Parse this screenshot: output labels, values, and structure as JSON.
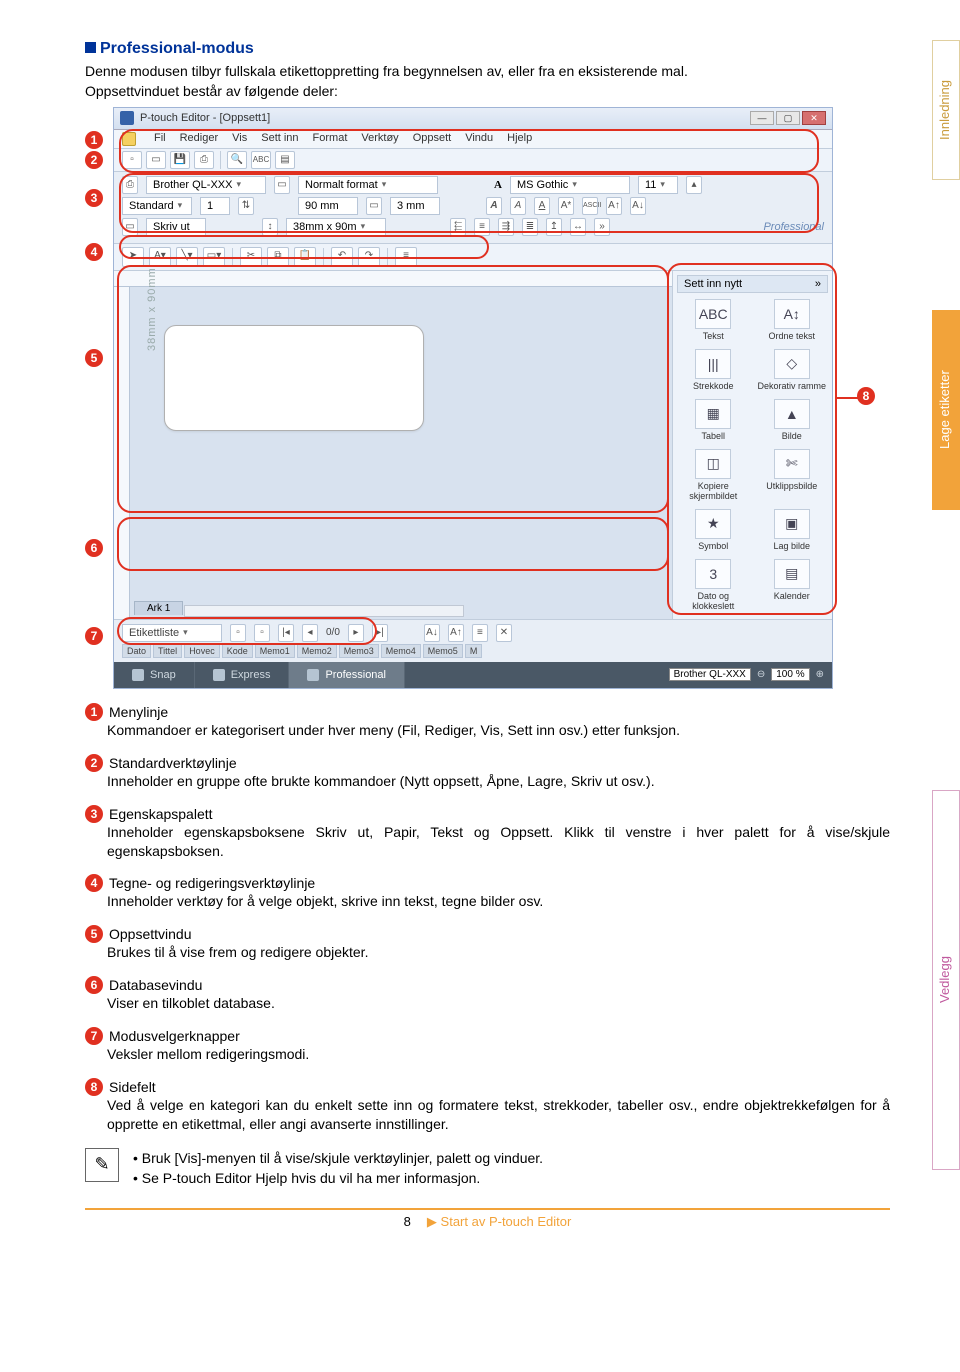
{
  "header": "Professional-modus",
  "intro_line1": "Denne modusen tilbyr fullskala etikettoppretting fra begynnelsen av, eller fra en eksisterende mal.",
  "intro_line2": "Oppsettvinduet består av følgende deler:",
  "side_tabs": {
    "top": "Innledning",
    "mid": "Lage etiketter",
    "bot": "Vedlegg"
  },
  "screenshot": {
    "title": "P-touch Editor - [Oppsett1]",
    "menus": [
      "Fil",
      "Rediger",
      "Vis",
      "Sett inn",
      "Format",
      "Verktøy",
      "Oppsett",
      "Vindu",
      "Hjelp"
    ],
    "printer": "Brother QL-XXX",
    "format": "Normalt format",
    "font": "MS Gothic",
    "fontsize": "11",
    "standard": "Standard",
    "qty": "1",
    "w": "90 mm",
    "h": "3 mm",
    "skrivut": "Skriv ut",
    "dims": "38mm x 90m",
    "mode_label": "Professional",
    "side_header": "Sett inn nytt",
    "side_items": [
      {
        "icon": "ABC",
        "label": "Tekst"
      },
      {
        "icon": "A↕",
        "label": "Ordne tekst"
      },
      {
        "icon": "|||",
        "label": "Strekkode"
      },
      {
        "icon": "◇",
        "label": "Dekorativ ramme"
      },
      {
        "icon": "▦",
        "label": "Tabell"
      },
      {
        "icon": "▲",
        "label": "Bilde"
      },
      {
        "icon": "◫",
        "label": "Kopiere skjermbildet"
      },
      {
        "icon": "✄",
        "label": "Utklippsbilde"
      },
      {
        "icon": "★",
        "label": "Symbol"
      },
      {
        "icon": "▣",
        "label": "Lag bilde"
      },
      {
        "icon": "3",
        "label": "Dato og klokkeslett"
      },
      {
        "icon": "▤",
        "label": "Kalender"
      }
    ],
    "label_dim": "38mm  x 90mm",
    "ark_tab": "Ark 1",
    "etikettliste": "Etikettliste",
    "db_nav": "0/0",
    "db_cols": [
      "Dato",
      "Tittel",
      "Hovec",
      "Kode",
      "Memo1",
      "Memo2",
      "Memo3",
      "Memo4",
      "Memo5",
      "M"
    ],
    "modes": [
      "Snap",
      "Express",
      "Professional"
    ],
    "zoom_printer": "Brother QL-XXX",
    "zoom": "100 %"
  },
  "items": [
    {
      "n": "1",
      "title": "Menylinje",
      "body": "Kommandoer er kategorisert under hver meny (Fil, Rediger, Vis, Sett inn osv.) etter funksjon."
    },
    {
      "n": "2",
      "title": "Standardverktøylinje",
      "body": "Inneholder en gruppe ofte brukte kommandoer (Nytt oppsett, Åpne, Lagre, Skriv ut osv.)."
    },
    {
      "n": "3",
      "title": "Egenskapspalett",
      "body": "Inneholder egenskapsboksene Skriv ut, Papir, Tekst og Oppsett. Klikk til venstre i hver palett for å vise/skjule egenskapsboksen."
    },
    {
      "n": "4",
      "title": "Tegne- og redigeringsverktøylinje",
      "body": "Inneholder verktøy for å velge objekt, skrive inn tekst, tegne bilder osv."
    },
    {
      "n": "5",
      "title": "Oppsettvindu",
      "body": "Brukes til å vise frem og redigere objekter."
    },
    {
      "n": "6",
      "title": "Databasevindu",
      "body": "Viser en tilkoblet database."
    },
    {
      "n": "7",
      "title": "Modusvelgerknapper",
      "body": "Veksler mellom redigeringsmodi."
    },
    {
      "n": "8",
      "title": "Sidefelt",
      "body": "Ved å velge en kategori kan du enkelt sette inn og formatere tekst, strekkoder, tabeller osv., endre objektrekkefølgen for å opprette en etikettmal, eller angi avanserte innstillinger."
    }
  ],
  "notes": [
    "Bruk [Vis]-menyen til å vise/skjule verktøylinjer, palett og vinduer.",
    "Se P-touch Editor Hjelp hvis du vil ha mer informasjon."
  ],
  "footer": {
    "page": "8",
    "link": "Start av P-touch Editor"
  }
}
